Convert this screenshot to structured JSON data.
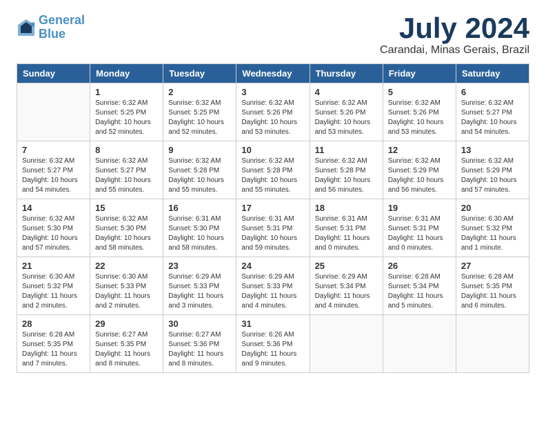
{
  "header": {
    "logo_line1": "General",
    "logo_line2": "Blue",
    "month": "July 2024",
    "location": "Carandai, Minas Gerais, Brazil"
  },
  "weekdays": [
    "Sunday",
    "Monday",
    "Tuesday",
    "Wednesday",
    "Thursday",
    "Friday",
    "Saturday"
  ],
  "weeks": [
    [
      {
        "day": "",
        "detail": ""
      },
      {
        "day": "1",
        "detail": "Sunrise: 6:32 AM\nSunset: 5:25 PM\nDaylight: 10 hours\nand 52 minutes."
      },
      {
        "day": "2",
        "detail": "Sunrise: 6:32 AM\nSunset: 5:25 PM\nDaylight: 10 hours\nand 52 minutes."
      },
      {
        "day": "3",
        "detail": "Sunrise: 6:32 AM\nSunset: 5:26 PM\nDaylight: 10 hours\nand 53 minutes."
      },
      {
        "day": "4",
        "detail": "Sunrise: 6:32 AM\nSunset: 5:26 PM\nDaylight: 10 hours\nand 53 minutes."
      },
      {
        "day": "5",
        "detail": "Sunrise: 6:32 AM\nSunset: 5:26 PM\nDaylight: 10 hours\nand 53 minutes."
      },
      {
        "day": "6",
        "detail": "Sunrise: 6:32 AM\nSunset: 5:27 PM\nDaylight: 10 hours\nand 54 minutes."
      }
    ],
    [
      {
        "day": "7",
        "detail": "Sunrise: 6:32 AM\nSunset: 5:27 PM\nDaylight: 10 hours\nand 54 minutes."
      },
      {
        "day": "8",
        "detail": "Sunrise: 6:32 AM\nSunset: 5:27 PM\nDaylight: 10 hours\nand 55 minutes."
      },
      {
        "day": "9",
        "detail": "Sunrise: 6:32 AM\nSunset: 5:28 PM\nDaylight: 10 hours\nand 55 minutes."
      },
      {
        "day": "10",
        "detail": "Sunrise: 6:32 AM\nSunset: 5:28 PM\nDaylight: 10 hours\nand 55 minutes."
      },
      {
        "day": "11",
        "detail": "Sunrise: 6:32 AM\nSunset: 5:28 PM\nDaylight: 10 hours\nand 56 minutes."
      },
      {
        "day": "12",
        "detail": "Sunrise: 6:32 AM\nSunset: 5:29 PM\nDaylight: 10 hours\nand 56 minutes."
      },
      {
        "day": "13",
        "detail": "Sunrise: 6:32 AM\nSunset: 5:29 PM\nDaylight: 10 hours\nand 57 minutes."
      }
    ],
    [
      {
        "day": "14",
        "detail": "Sunrise: 6:32 AM\nSunset: 5:30 PM\nDaylight: 10 hours\nand 57 minutes."
      },
      {
        "day": "15",
        "detail": "Sunrise: 6:32 AM\nSunset: 5:30 PM\nDaylight: 10 hours\nand 58 minutes."
      },
      {
        "day": "16",
        "detail": "Sunrise: 6:31 AM\nSunset: 5:30 PM\nDaylight: 10 hours\nand 58 minutes."
      },
      {
        "day": "17",
        "detail": "Sunrise: 6:31 AM\nSunset: 5:31 PM\nDaylight: 10 hours\nand 59 minutes."
      },
      {
        "day": "18",
        "detail": "Sunrise: 6:31 AM\nSunset: 5:31 PM\nDaylight: 11 hours\nand 0 minutes."
      },
      {
        "day": "19",
        "detail": "Sunrise: 6:31 AM\nSunset: 5:31 PM\nDaylight: 11 hours\nand 0 minutes."
      },
      {
        "day": "20",
        "detail": "Sunrise: 6:30 AM\nSunset: 5:32 PM\nDaylight: 11 hours\nand 1 minute."
      }
    ],
    [
      {
        "day": "21",
        "detail": "Sunrise: 6:30 AM\nSunset: 5:32 PM\nDaylight: 11 hours\nand 2 minutes."
      },
      {
        "day": "22",
        "detail": "Sunrise: 6:30 AM\nSunset: 5:33 PM\nDaylight: 11 hours\nand 2 minutes."
      },
      {
        "day": "23",
        "detail": "Sunrise: 6:29 AM\nSunset: 5:33 PM\nDaylight: 11 hours\nand 3 minutes."
      },
      {
        "day": "24",
        "detail": "Sunrise: 6:29 AM\nSunset: 5:33 PM\nDaylight: 11 hours\nand 4 minutes."
      },
      {
        "day": "25",
        "detail": "Sunrise: 6:29 AM\nSunset: 5:34 PM\nDaylight: 11 hours\nand 4 minutes."
      },
      {
        "day": "26",
        "detail": "Sunrise: 6:28 AM\nSunset: 5:34 PM\nDaylight: 11 hours\nand 5 minutes."
      },
      {
        "day": "27",
        "detail": "Sunrise: 6:28 AM\nSunset: 5:35 PM\nDaylight: 11 hours\nand 6 minutes."
      }
    ],
    [
      {
        "day": "28",
        "detail": "Sunrise: 6:28 AM\nSunset: 5:35 PM\nDaylight: 11 hours\nand 7 minutes."
      },
      {
        "day": "29",
        "detail": "Sunrise: 6:27 AM\nSunset: 5:35 PM\nDaylight: 11 hours\nand 8 minutes."
      },
      {
        "day": "30",
        "detail": "Sunrise: 6:27 AM\nSunset: 5:36 PM\nDaylight: 11 hours\nand 8 minutes."
      },
      {
        "day": "31",
        "detail": "Sunrise: 6:26 AM\nSunset: 5:36 PM\nDaylight: 11 hours\nand 9 minutes."
      },
      {
        "day": "",
        "detail": ""
      },
      {
        "day": "",
        "detail": ""
      },
      {
        "day": "",
        "detail": ""
      }
    ]
  ]
}
